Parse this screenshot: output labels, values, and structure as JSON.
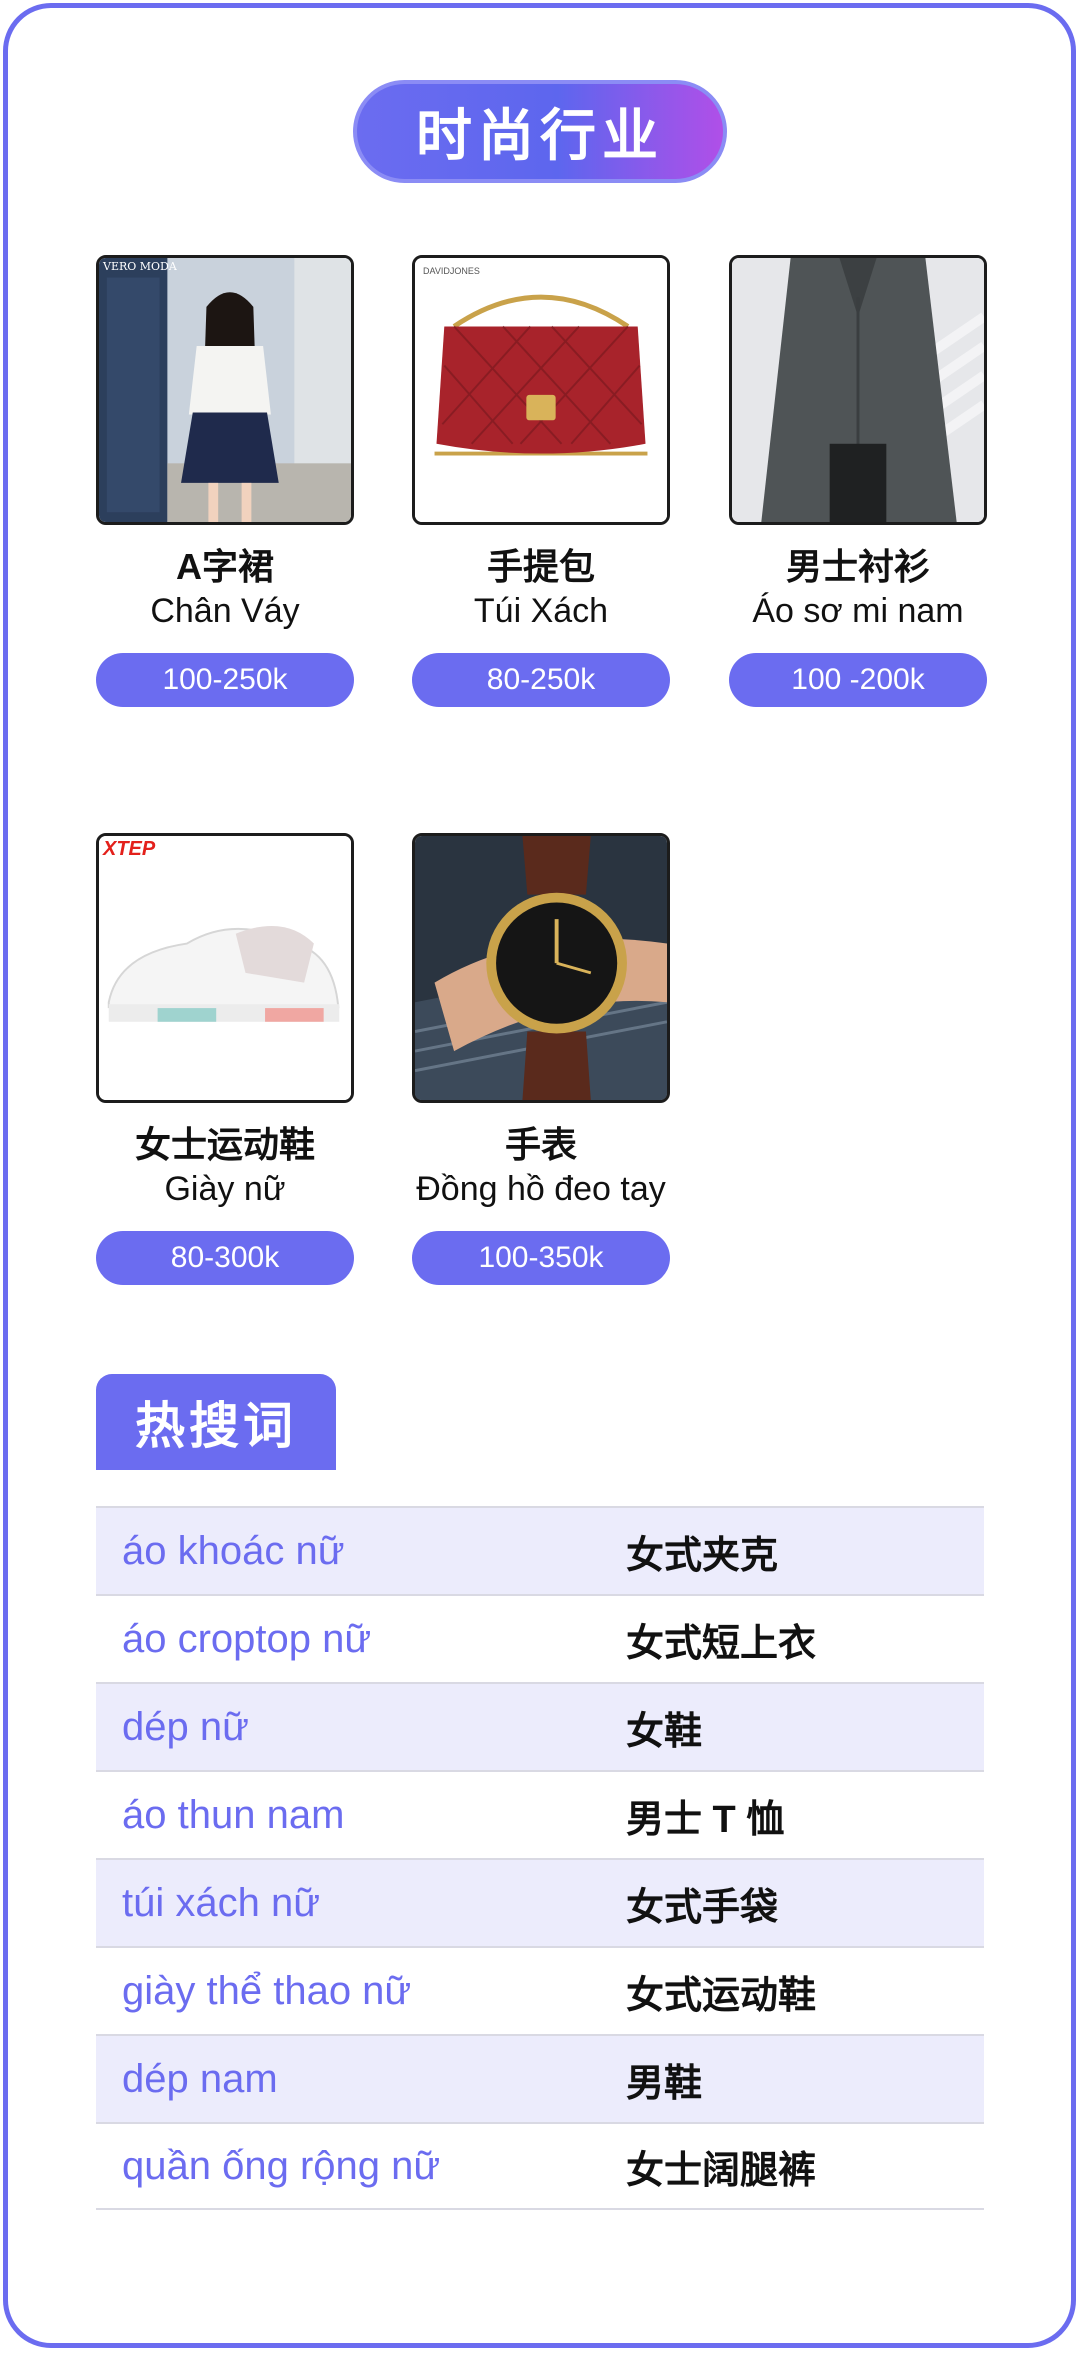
{
  "section_title": "时尚行业",
  "products": [
    {
      "cn": "A字裙",
      "vn": "Chân Váy",
      "price": "100-250k",
      "image": "skirt-photo",
      "brand": "VERO MODA"
    },
    {
      "cn": "手提包",
      "vn": "Túi Xách",
      "price": "80-250k",
      "image": "handbag-photo",
      "brand": "DAVIDJONES"
    },
    {
      "cn": "男士衬衫",
      "vn": "Áo sơ mi nam",
      "price": "100 -200k",
      "image": "shirt-photo",
      "brand": ""
    },
    {
      "cn": "女士运动鞋",
      "vn": "Giày nữ",
      "price": "80-300k",
      "image": "sneaker-photo",
      "brand": "XTEP"
    },
    {
      "cn": "手表",
      "vn": "Đồng hồ đeo tay",
      "price": "100-350k",
      "image": "watch-photo",
      "brand": ""
    }
  ],
  "hot_search": {
    "title": "热搜词",
    "rows": [
      {
        "vn": "áo khoác nữ",
        "cn": "女式夹克"
      },
      {
        "vn": "áo croptop nữ",
        "cn": "女式短上衣"
      },
      {
        "vn": "dép nữ",
        "cn": "女鞋"
      },
      {
        "vn": "áo thun nam",
        "cn": "男士 T 恤"
      },
      {
        "vn": "túi xách nữ",
        "cn": "女式手袋"
      },
      {
        "vn": "giày thể thao nữ",
        "cn": "女式运动鞋"
      },
      {
        "vn": "dép nam",
        "cn": "男鞋"
      },
      {
        "vn": "quần ống rộng nữ",
        "cn": "女士阔腿裤"
      }
    ]
  },
  "colors": {
    "accent": "#6b6cf0",
    "row_alt": "#ececfc",
    "text": "#111111"
  }
}
